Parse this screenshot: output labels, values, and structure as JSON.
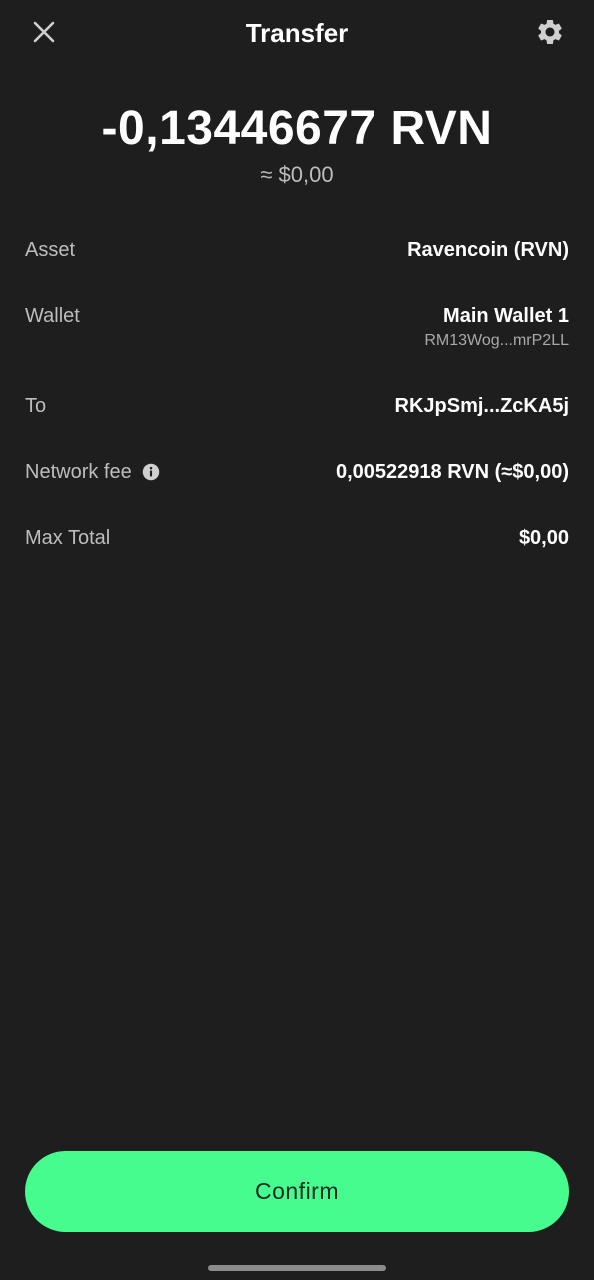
{
  "header": {
    "title": "Transfer",
    "close_icon": "close-icon",
    "settings_icon": "gear-icon"
  },
  "amount": {
    "crypto": "-0,13446677 RVN",
    "fiat": "≈ $0,00"
  },
  "details": {
    "asset": {
      "label": "Asset",
      "value": "Ravencoin (RVN)"
    },
    "wallet": {
      "label": "Wallet",
      "value": "Main Wallet 1",
      "address": "RM13Wog...mrP2LL"
    },
    "to": {
      "label": "To",
      "value": "RKJpSmj...ZcKA5j"
    },
    "network_fee": {
      "label": "Network fee",
      "value": "0,00522918 RVN (≈$0,00)",
      "info_icon": "info-icon"
    },
    "max_total": {
      "label": "Max Total",
      "value": "$0,00"
    }
  },
  "confirm": {
    "label": "Confirm"
  },
  "colors": {
    "background": "#1e1e1e",
    "accent": "#46fc8e",
    "muted_text": "#bdbdbd"
  }
}
